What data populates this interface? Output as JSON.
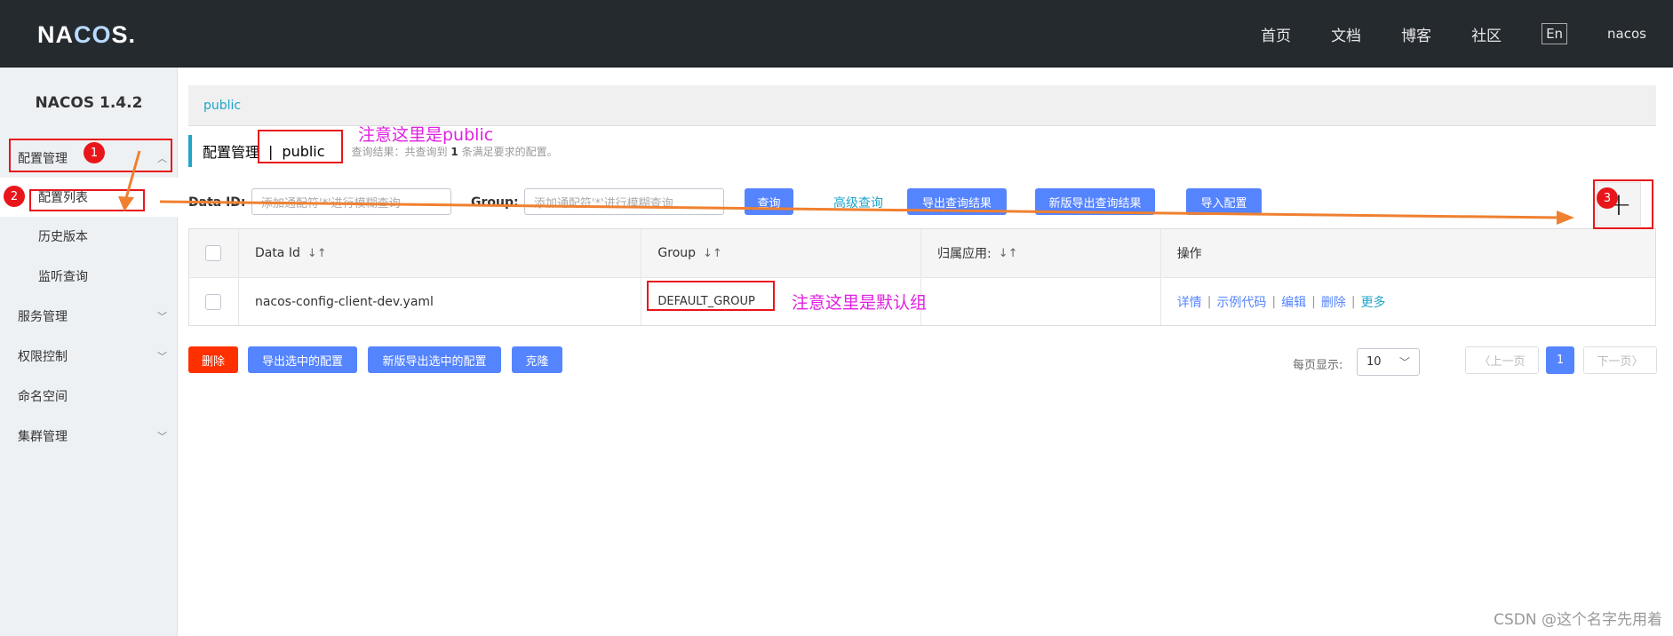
{
  "brand": {
    "logo_left": "NA",
    "logo_mid": "CO",
    "logo_right": "S."
  },
  "topnav": {
    "links": [
      "首页",
      "文档",
      "博客",
      "社区"
    ],
    "lang": "En",
    "user": "nacos"
  },
  "sidebar": {
    "version": "NACOS 1.4.2",
    "items": [
      {
        "label": "配置管理"
      },
      {
        "label": "配置列表"
      },
      {
        "label": "历史版本"
      },
      {
        "label": "监听查询"
      },
      {
        "label": "服务管理"
      },
      {
        "label": "权限控制"
      },
      {
        "label": "命名空间"
      },
      {
        "label": "集群管理"
      }
    ]
  },
  "namespace_bar": {
    "label": "public"
  },
  "title": {
    "main": "配置管理",
    "sep": "|",
    "namespace": "public",
    "result_prefix": "查询结果：共查询到",
    "result_count": "1",
    "result_suffix": "条满足要求的配置。"
  },
  "filters": {
    "data_id_label": "Data ID:",
    "data_id_placeholder": "添加通配符'*'进行模糊查询",
    "group_label": "Group:",
    "group_placeholder": "添加通配符'*'进行模糊查询",
    "query": "查询",
    "advanced": "高级查询",
    "export_results": "导出查询结果",
    "export_results_new": "新版导出查询结果",
    "import": "导入配置",
    "plus": "+"
  },
  "table": {
    "headers": [
      "Data Id",
      "Group",
      "归属应用:",
      "操作"
    ],
    "sort_icon": "↓↑",
    "rows": [
      {
        "data_id": "nacos-config-client-dev.yaml",
        "group": "DEFAULT_GROUP",
        "app": ""
      }
    ],
    "ops": [
      "详情",
      "示例代码",
      "编辑",
      "删除",
      "更多"
    ],
    "op_sep": "|"
  },
  "bottom": {
    "delete": "删除",
    "export_selected": "导出选中的配置",
    "export_selected_new": "新版导出选中的配置",
    "clone": "克隆",
    "page_size_label": "每页显示:",
    "page_size": "10",
    "prev": "上一页",
    "page": "1",
    "next": "下一页"
  },
  "annotations": {
    "note_public": "注意这里是public",
    "note_group": "注意这里是默认组",
    "markers": [
      "1",
      "2",
      "3"
    ]
  },
  "watermark": "CSDN @这个名字先用着",
  "colors": {
    "topbar": "#252a2f",
    "primary": "#5584ff",
    "danger": "#ff3000",
    "accent": "#21a5c9",
    "annotation": "#e8161b",
    "annotation_text": "#e120e1"
  }
}
